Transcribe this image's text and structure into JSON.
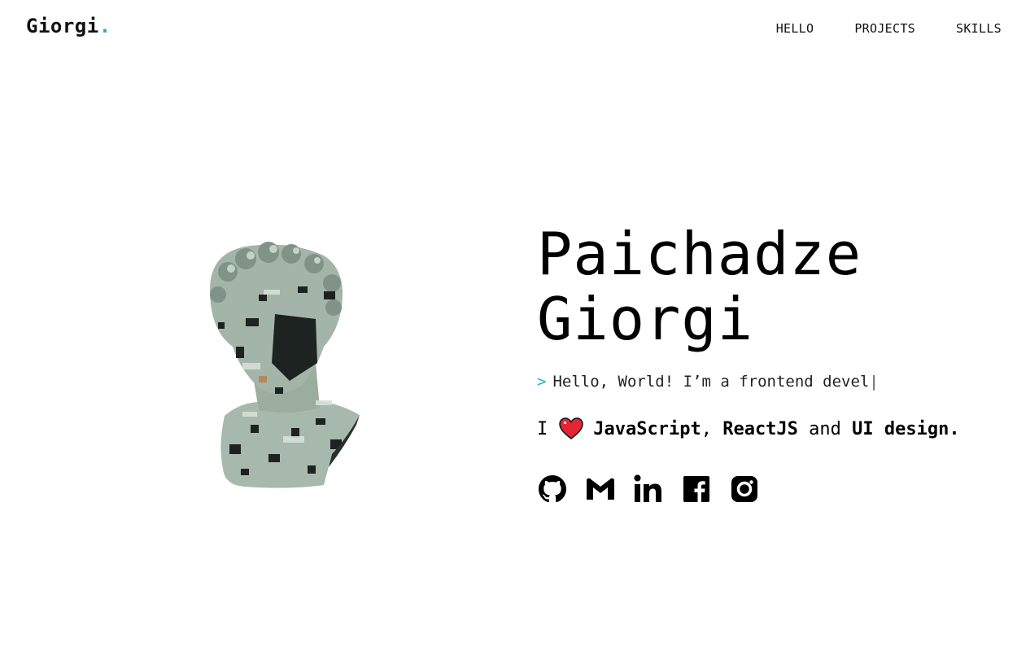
{
  "header": {
    "logo_text": "Giorgi",
    "logo_dot": ".",
    "nav": [
      {
        "label": "HELLO"
      },
      {
        "label": "PROJECTS"
      },
      {
        "label": "SKILLS"
      }
    ]
  },
  "hero": {
    "name_line1": "Paichadze",
    "name_line2": "Giorgi",
    "prompt_symbol": ">",
    "typed_text": "Hello, World! I’m a frontend devel",
    "caret": "|",
    "love": {
      "prefix": "I",
      "icon": "heart-icon",
      "item1": "JavaScript",
      "sep": ",",
      "item2": "ReactJS",
      "conj": "and",
      "item3": "UI design."
    },
    "socials": [
      {
        "icon": "github-icon"
      },
      {
        "icon": "gmail-icon"
      },
      {
        "icon": "linkedin-icon"
      },
      {
        "icon": "facebook-icon"
      },
      {
        "icon": "instagram-icon"
      }
    ]
  },
  "colors": {
    "accent": "#3aa7c9",
    "heart": "#e32636",
    "statue": "#9fb0a5"
  }
}
